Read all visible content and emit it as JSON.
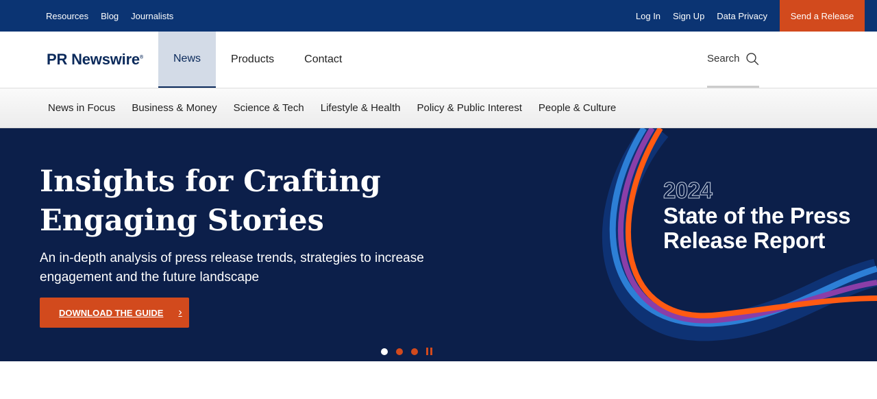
{
  "topbar": {
    "left_links": [
      "Resources",
      "Blog",
      "Journalists"
    ],
    "right_links": [
      "Log In",
      "Sign Up",
      "Data Privacy"
    ],
    "send_label": "Send a Release"
  },
  "header": {
    "logo": "PR Newswire",
    "logo_mark": "®",
    "nav": [
      {
        "label": "News",
        "active": true
      },
      {
        "label": "Products",
        "active": false
      },
      {
        "label": "Contact",
        "active": false
      }
    ],
    "search_label": "Search"
  },
  "categories": [
    "News in Focus",
    "Business & Money",
    "Science & Tech",
    "Lifestyle & Health",
    "Policy & Public Interest",
    "People & Culture"
  ],
  "hero": {
    "title": "Insights for Crafting Engaging Stories",
    "subtitle": "An in-depth analysis of press release trends, strategies to increase engagement and the future landscape",
    "cta_label": "DOWNLOAD THE GUIDE",
    "report_year": "2024",
    "report_title_line1": "State of the Press",
    "report_title_line2": "Release Report",
    "slides_total": 3,
    "slide_active": 1
  },
  "colors": {
    "navy": "#0b3473",
    "hero_bg": "#0c1f4a",
    "accent": "#d24a1d"
  }
}
